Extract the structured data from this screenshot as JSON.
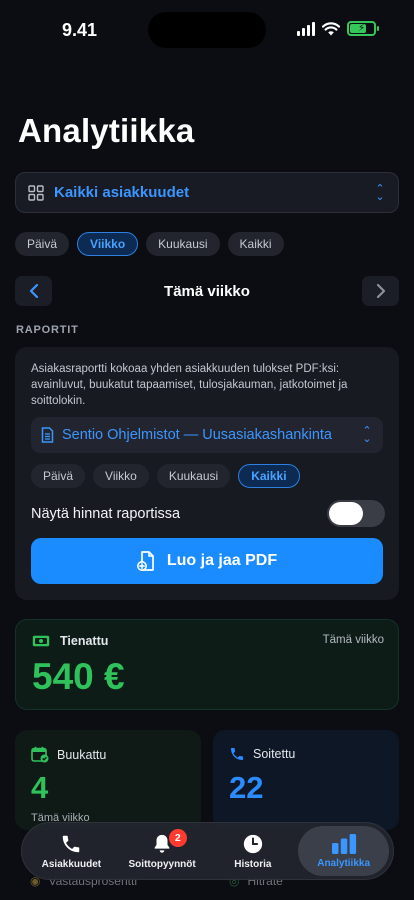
{
  "status_bar": {
    "time": "9.41"
  },
  "header": {
    "title": "Analytiikka"
  },
  "customer_select": {
    "label": "Kaikki asiakkuudet"
  },
  "period_filters": [
    "Päivä",
    "Viikko",
    "Kuukausi",
    "Kaikki"
  ],
  "period_filters_active": "Viikko",
  "week_nav": {
    "label": "Tämä viikko"
  },
  "reports": {
    "section_label": "RAPORTIT",
    "description": "Asiakasraportti kokoaa yhden asiakkuuden tulokset PDF:ksi: avainluvut, buukatut tapaamiset, tulosjakauman, jatkotoimet ja soittolokin.",
    "customer_label": "Sentio Ohjelmistot — Uusasiakashankinta",
    "filters": [
      "Päivä",
      "Viikko",
      "Kuukausi",
      "Kaikki"
    ],
    "filters_active": "Kaikki",
    "show_prices_label": "Näytä hinnat raportissa",
    "show_prices_on": false,
    "pdf_button_label": "Luo ja jaa PDF"
  },
  "earned": {
    "label": "Tienattu",
    "period": "Tämä viikko",
    "value": "540 €"
  },
  "booked": {
    "label": "Buukattu",
    "value": "4",
    "period": "Tämä viikko"
  },
  "called": {
    "label": "Soitettu",
    "value": "22"
  },
  "peek": {
    "left_label": "Vastausprosentti",
    "right_label": "Hitrate"
  },
  "tab_bar": {
    "tabs": [
      {
        "label": "Asiakkuudet",
        "icon": "phone-icon"
      },
      {
        "label": "Soittopyynnöt",
        "icon": "bell-icon",
        "badge": "2"
      },
      {
        "label": "Historia",
        "icon": "clock-icon"
      },
      {
        "label": "Analytiikka",
        "icon": "chart-icon"
      }
    ],
    "active": "Analytiikka"
  },
  "colors": {
    "accent": "#1a8cff",
    "green": "#2fc25b",
    "background": "#0b0d12"
  }
}
